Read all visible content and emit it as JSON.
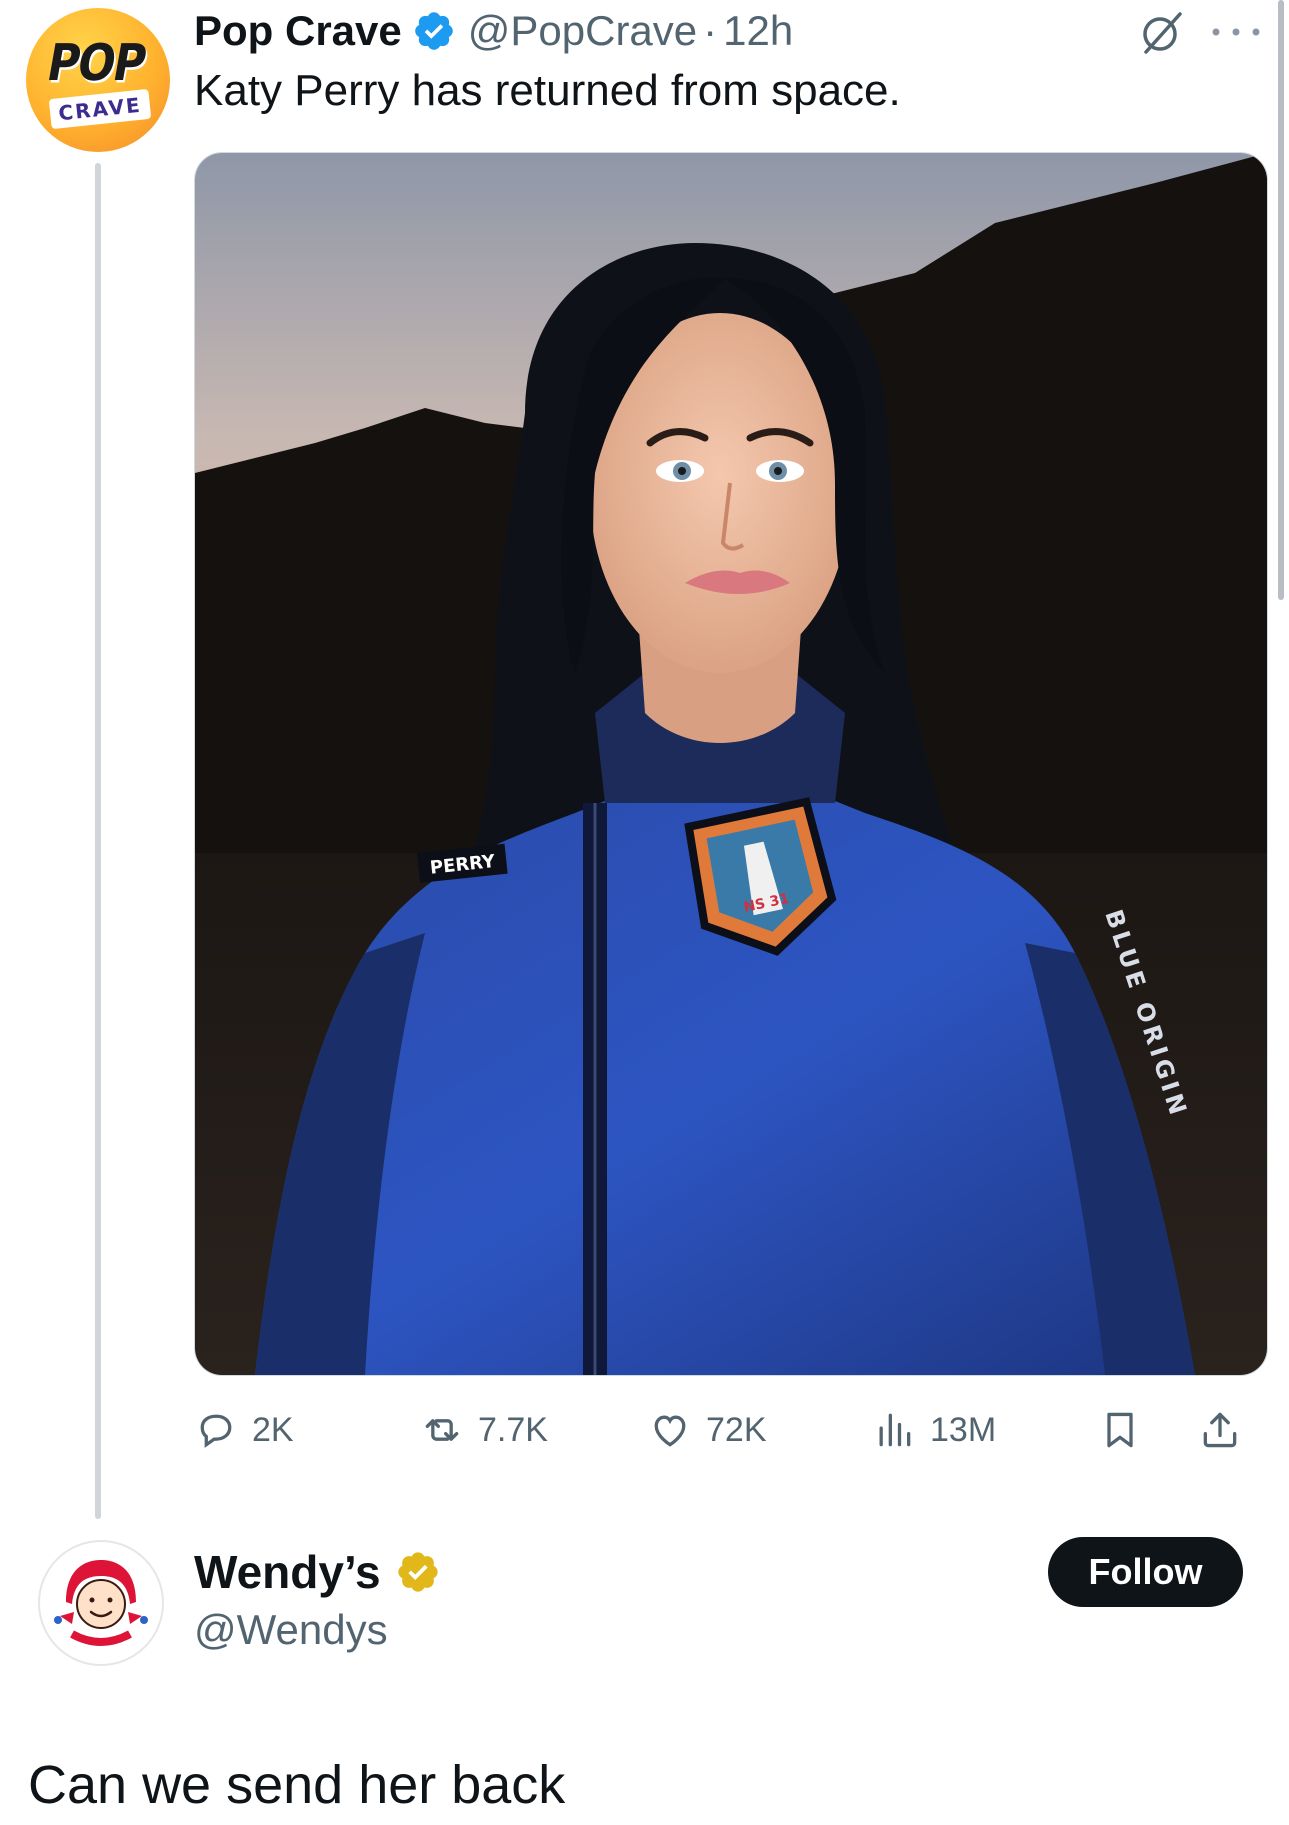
{
  "tweet": {
    "author_name": "Pop Crave",
    "author_handle": "@PopCrave",
    "separator": "·",
    "time": "12h",
    "text": "Katy Perry has returned from space.",
    "avatar": {
      "text_top": "POP",
      "text_bottom": "CRAVE"
    },
    "photo": {
      "name_tag": "PERRY",
      "patch_text": "NS 31",
      "sleeve_text": "BLUE ORIGIN"
    },
    "actions": {
      "replies": "2K",
      "reposts": "7.7K",
      "likes": "72K",
      "views": "13M"
    },
    "icons": [
      "verified-badge-icon",
      "grok-icon",
      "more-icon",
      "reply-icon",
      "repost-icon",
      "like-icon",
      "views-icon",
      "bookmark-icon",
      "share-icon"
    ]
  },
  "reply": {
    "author_name": "Wendy’s",
    "author_handle": "@Wendys",
    "follow_label": "Follow",
    "text": "Can we send her back"
  },
  "colors": {
    "verified_blue": "#1d9bf0",
    "verified_gold": "#e2b719",
    "text_primary": "#0f1419",
    "text_secondary": "#536471",
    "follow_bg": "#0f1419"
  }
}
